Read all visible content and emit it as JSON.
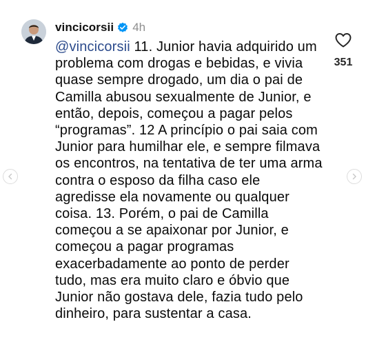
{
  "comment": {
    "username": "vincicorsii",
    "time": "4h",
    "mention": "@vincicorsii",
    "body": " 11. Junior havia adquirido um problema com drogas e bebidas, e vivia quase sempre drogado, um dia o pai de Camilla abusou sexualmente de Junior, e então, depois, começou a pagar pelos “programas”. 12 A princípio o pai saia com Junior para humilhar ele, e sempre filmava os encontros, na tentativa de ter uma arma contra o esposo da filha caso ele agredisse ela novamente ou qualquer coisa. 13. Porém, o pai de Camilla começou a se apaixonar por Junior, e começou a pagar programas exacerbadamente ao ponto de perder tudo, mas era muito claro e óbvio que Junior não gostava dele, fazia tudo pelo dinheiro, para sustentar a casa.",
    "likes": "351"
  },
  "icons": {
    "verified": "verified-badge-icon",
    "like": "heart-icon",
    "prev": "chevron-left-icon",
    "next": "chevron-right-icon"
  },
  "colors": {
    "mention": "#2c4b8c",
    "verified": "#0095f6",
    "time": "#8e8e8e"
  }
}
